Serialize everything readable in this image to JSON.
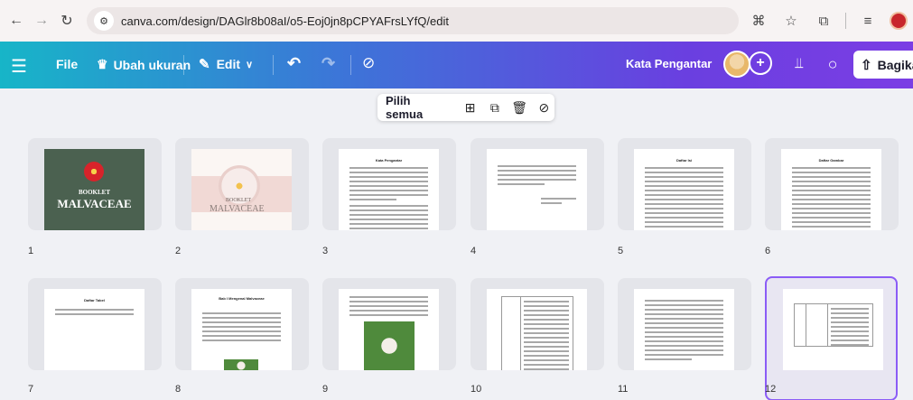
{
  "browser": {
    "url": "canva.com/design/DAGlr8b08aI/o5-Eoj0jn8pCPYAFrsLYfQ/edit",
    "back_icon": "arrow-left-icon",
    "forward_icon": "arrow-right-icon",
    "reload_icon": "reload-icon"
  },
  "toolbar": {
    "file_label": "File",
    "resize_label": "Ubah ukuran",
    "edit_label": "Edit",
    "doc_title": "Kata Pengantar",
    "share_label": "Bagika",
    "gradient_colors": [
      "#17b5c8",
      "#3d74d8",
      "#6a3fe0",
      "#7b3ee4"
    ]
  },
  "selection_bar": {
    "select_all_label": "Pilih semua"
  },
  "pages": [
    {
      "number": "1",
      "kind": "cover-dark",
      "title_small": "BOOKLET",
      "title_big": "MALVACEAE"
    },
    {
      "number": "2",
      "kind": "cover-light",
      "title_small": "BOOKLET",
      "title_big": "MALVACEAE"
    },
    {
      "number": "3",
      "kind": "text",
      "heading": "Kata Pengantar"
    },
    {
      "number": "4",
      "kind": "text-short"
    },
    {
      "number": "5",
      "kind": "toc",
      "heading": "Daftar Isi"
    },
    {
      "number": "6",
      "kind": "toc",
      "heading": "Daftar Gambar"
    },
    {
      "number": "7",
      "kind": "toc-short",
      "heading": "Daftar Tabel"
    },
    {
      "number": "8",
      "kind": "chapter",
      "heading": "Bab I Mengenal Malvaceae"
    },
    {
      "number": "9",
      "kind": "photo"
    },
    {
      "number": "10",
      "kind": "table"
    },
    {
      "number": "11",
      "kind": "text"
    },
    {
      "number": "12",
      "kind": "table",
      "selected": true
    }
  ]
}
